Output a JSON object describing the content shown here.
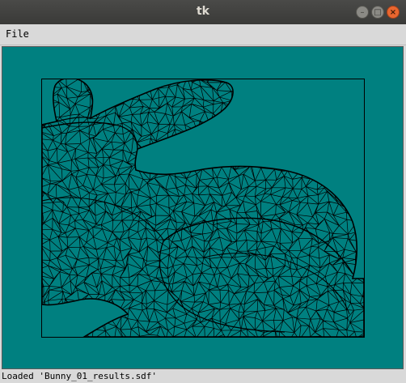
{
  "window": {
    "title": "tk"
  },
  "window_buttons": {
    "minimize": "–",
    "maximize": "□",
    "close": "×"
  },
  "menu": {
    "items": [
      {
        "label": "File"
      }
    ]
  },
  "canvas": {
    "background": "#008080",
    "mesh_color": "#000000",
    "model": "bunny-mesh"
  },
  "status": {
    "text": "Loaded 'Bunny_01_results.sdf'"
  }
}
